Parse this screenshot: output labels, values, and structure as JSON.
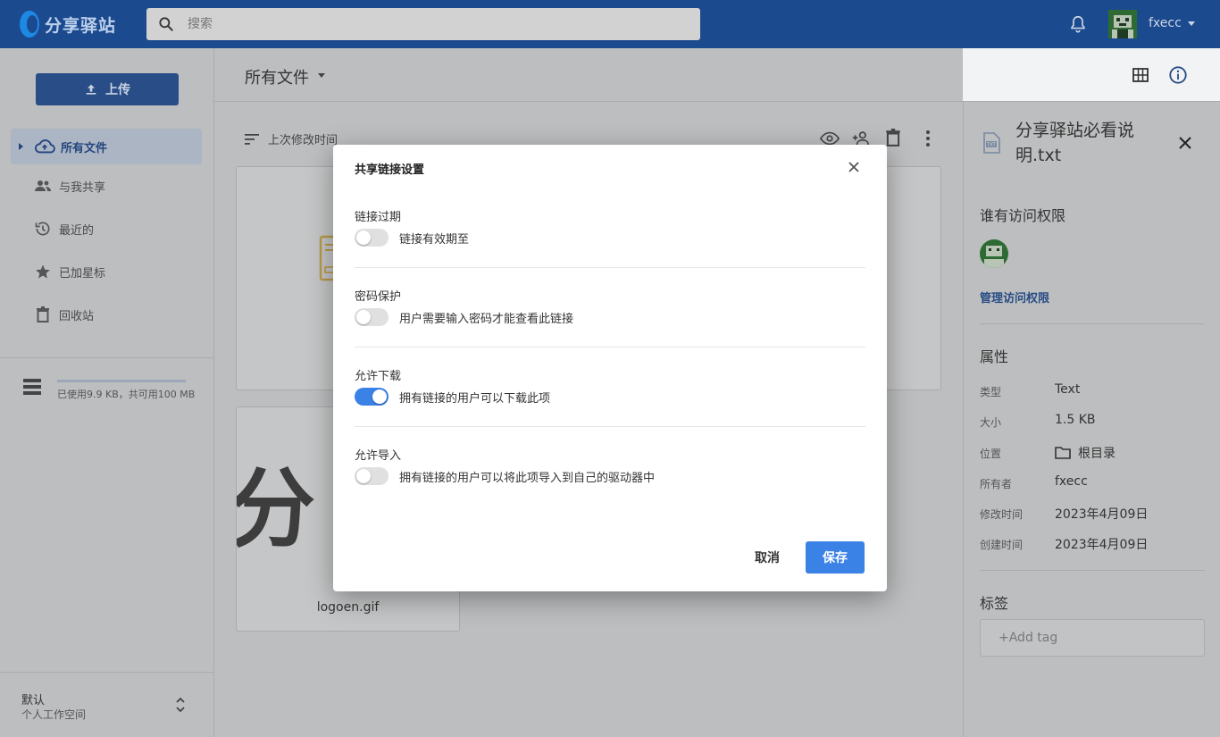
{
  "app": {
    "logo_text": "分享驿站"
  },
  "topbar": {
    "search_placeholder": "搜索",
    "username": "fxecc"
  },
  "sidebar": {
    "upload_label": "上传",
    "items": [
      {
        "label": "所有文件",
        "icon": "cloud-icon",
        "active": true
      },
      {
        "label": "与我共享",
        "icon": "people-icon"
      },
      {
        "label": "最近的",
        "icon": "history-icon"
      },
      {
        "label": "已加星标",
        "icon": "star-icon"
      },
      {
        "label": "回收站",
        "icon": "trash-icon"
      }
    ],
    "storage_text": "已使用9.9 KB，共可用100 MB",
    "workspace": {
      "title": "默认",
      "subtitle": "个人工作空间"
    }
  },
  "main": {
    "folder_title": "所有文件",
    "sort_label": "上次修改时间",
    "cards": [
      {
        "label": "分"
      },
      {
        "label": "logoen.gif",
        "preview_text": "分"
      }
    ]
  },
  "details": {
    "file_name": "分享驿站必看说明.txt",
    "access_heading": "谁有访问权限",
    "manage_access": "管理访问权限",
    "properties_heading": "属性",
    "properties": [
      {
        "label": "类型",
        "value": "Text"
      },
      {
        "label": "大小",
        "value": "1.5 KB"
      },
      {
        "label": "位置",
        "value": "根目录"
      },
      {
        "label": "所有者",
        "value": "fxecc"
      },
      {
        "label": "修改时间",
        "value": "2023年4月09日"
      },
      {
        "label": "创建时间",
        "value": "2023年4月09日"
      }
    ],
    "tags_heading": "标签",
    "tag_placeholder": "+Add tag"
  },
  "dialog": {
    "title": "共享链接设置",
    "sections": [
      {
        "title": "链接过期",
        "toggle_label": "链接有效期至",
        "enabled": false
      },
      {
        "title": "密码保护",
        "toggle_label": "用户需要输入密码才能查看此链接",
        "enabled": false
      },
      {
        "title": "允许下载",
        "toggle_label": "拥有链接的用户可以下载此项",
        "enabled": true
      },
      {
        "title": "允许导入",
        "toggle_label": "拥有链接的用户可以将此项导入到自己的驱动器中",
        "enabled": false
      }
    ],
    "cancel_label": "取消",
    "save_label": "保存"
  },
  "colors": {
    "accent": "#3b82e6",
    "topbar": "#1c4a8f",
    "link": "#284c85"
  }
}
